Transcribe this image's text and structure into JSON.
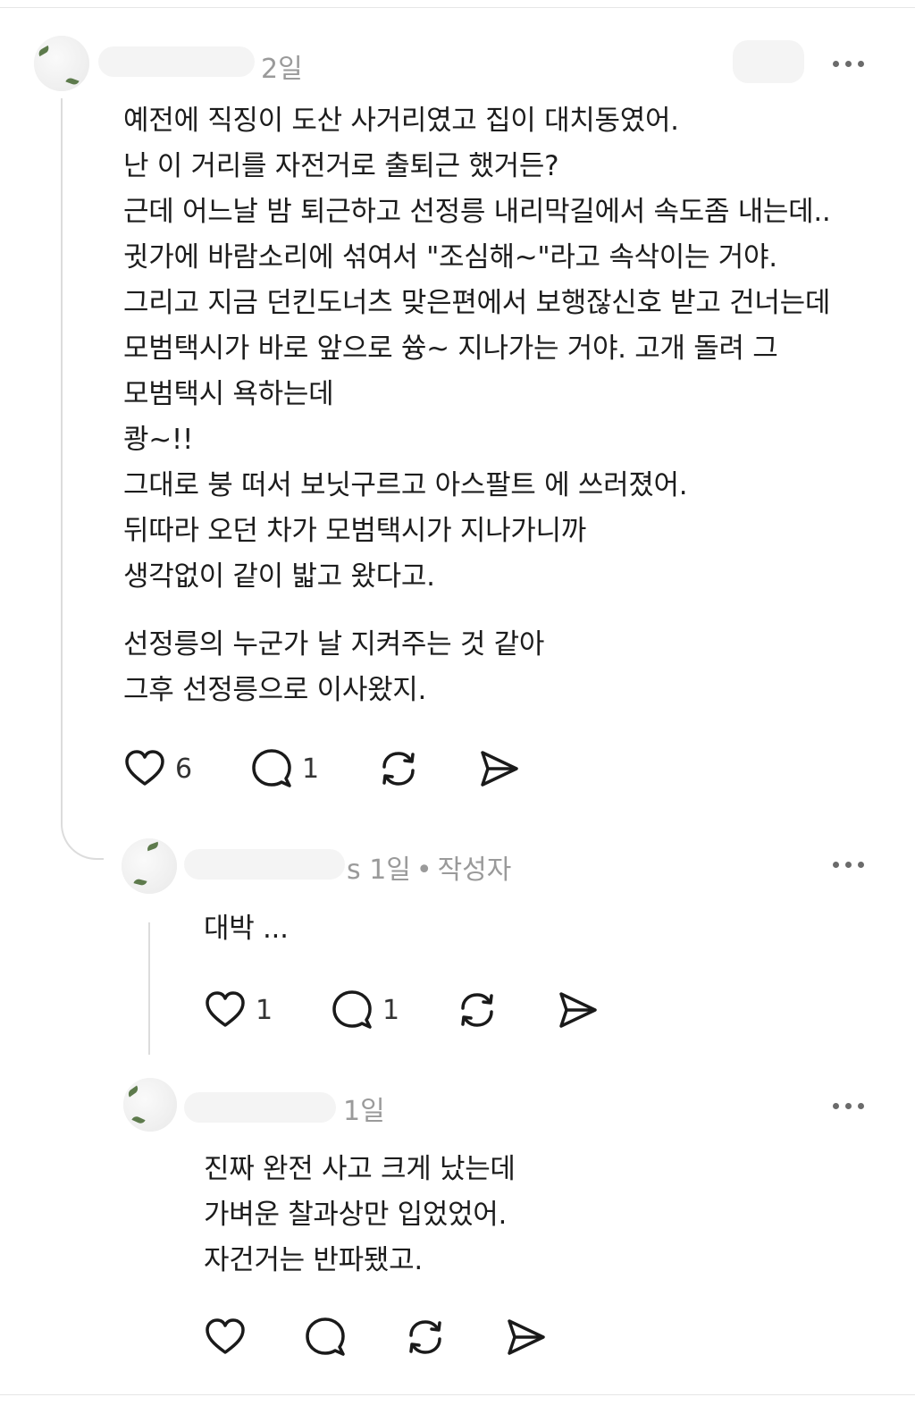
{
  "comments": [
    {
      "time": "2일",
      "lines": [
        "예전에 직징이 도산 사거리였고 집이 대치동였어.",
        "난 이 거리를 자전거로 출퇴근 했거든?",
        "근데 어느날 밤 퇴근하고 선정릉 내리막길에서 속도좀 내는데..",
        "귓가에 바람소리에 섞여서 \"조심해~\"라고 속삭이는 거야.",
        "그리고  지금 던킨도너츠 맞은편에서 보행잖신호 받고 건너는데",
        "모범택시가 바로 앞으로 쓩~ 지나가는 거야. 고개 돌려 그",
        "모범택시 욕하는데",
        "쾅~!!",
        "그대로 붕 떠서 보닛구르고 아스팔트 에 쓰러졌어.",
        "뒤따라 오던 차가 모범택시가 지나가니까",
        "생각없이 같이 밟고 왔다고."
      ],
      "lines2": [
        "선정릉의 누군가 날 지켜주는 것 같아",
        "그후 선정릉으로 이사왔지."
      ],
      "likes": "6",
      "replies": "1"
    },
    {
      "name_tail": "s",
      "time": "1일",
      "separator": "•",
      "author_badge": "작성자",
      "lines": [
        "대박 ..."
      ],
      "likes": "1",
      "replies": "1"
    },
    {
      "time": "1일",
      "lines": [
        "진짜 완전 사고 크게 났는데",
        "가벼운 찰과상만 입었었어.",
        "자건거는 반파됐고."
      ]
    }
  ],
  "icons": {
    "like": "heart-icon",
    "reply": "comment-bubble-icon",
    "repost": "repost-icon",
    "share": "send-icon",
    "more": "more-dots-icon"
  },
  "colors": {
    "text": "#1c1c1c",
    "meta": "#9a9a9a",
    "icon": "#1a1a1a",
    "thread_line": "#dcdcdc"
  }
}
